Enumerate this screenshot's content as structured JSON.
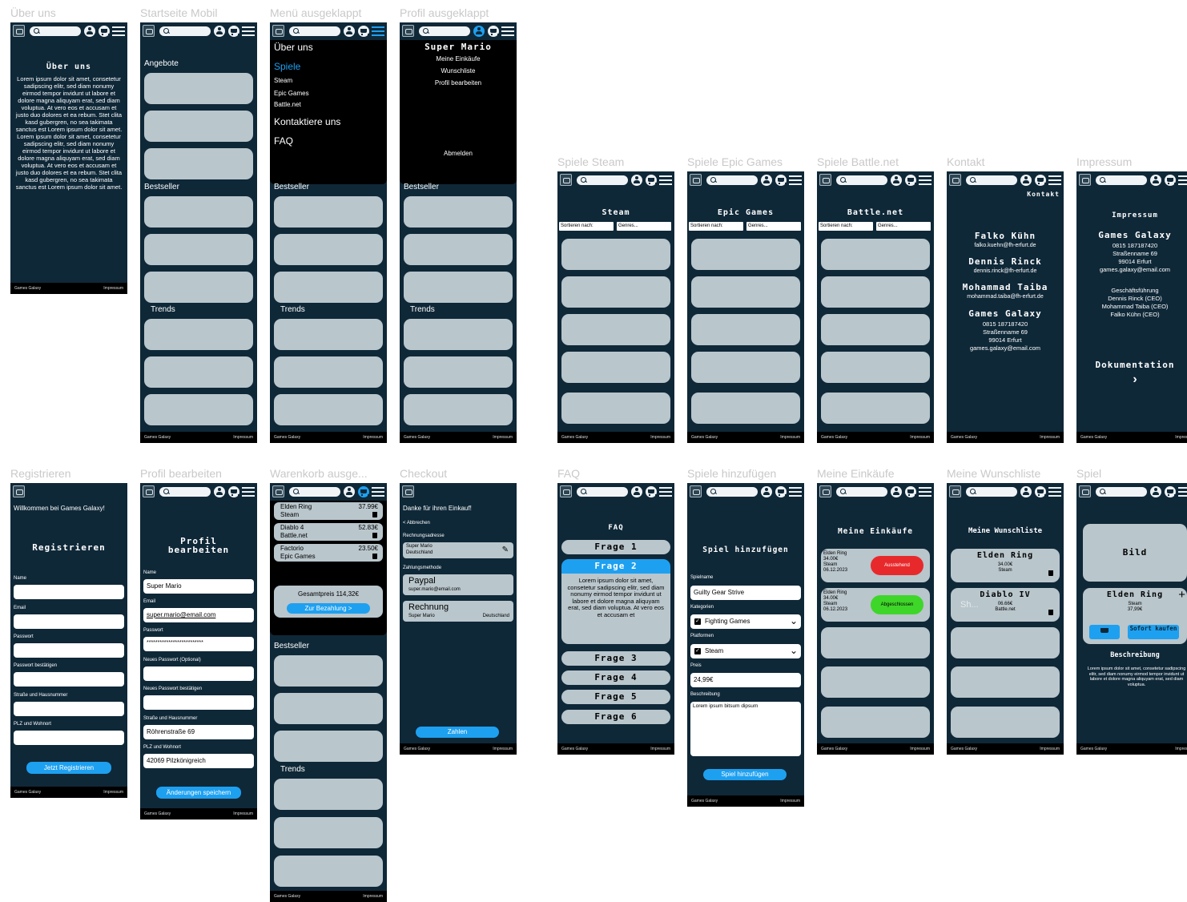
{
  "footer": {
    "left": "Games Galaxy",
    "right": "Impressum"
  },
  "labels": {
    "ueber": "Über uns",
    "start": "Startseite Mobil",
    "menu": "Menü ausgeklappt",
    "profil": "Profil ausgeklappt",
    "steam": "Spiele Steam",
    "epic": "Spiele Epic Games",
    "bnet": "Spiele Battle.net",
    "kontakt": "Kontakt",
    "impressum": "Impressum",
    "registrieren": "Registrieren",
    "profbearb": "Profil bearbeiten",
    "warenkorb": "Warenkorb ausge...",
    "checkout": "Checkout",
    "faq": "FAQ",
    "hinzu": "Spiele hinzufügen",
    "einkaeufe": "Meine Einkäufe",
    "wunsch": "Meine Wunschliste",
    "spiel": "Spiel"
  },
  "sections": {
    "angebote": "Angebote",
    "bestseller": "Bestseller",
    "trends": "Trends"
  },
  "ueber": {
    "title": "Über uns",
    "text": "Lorem ipsum dolor sit amet, consetetur sadipscing elitr, sed diam nonumy eirmod tempor invidunt ut labore et dolore magna aliquyam erat, sed diam voluptua. At vero eos et accusam et justo duo dolores et ea rebum. Stet clita kasd gubergren, no sea takimata sanctus est Lorem ipsum dolor sit amet. Lorem ipsum dolor sit amet, consetetur sadipscing elitr, sed diam nonumy eirmod tempor invidunt ut labore et dolore magna aliquyam erat, sed diam voluptua. At vero eos et accusam et justo duo dolores et ea rebum. Stet clita kasd gubergren, no sea takimata sanctus est Lorem ipsum dolor sit amet."
  },
  "menu": {
    "ueber": "Über uns",
    "spiele": "Spiele",
    "steam": "Steam",
    "epic": "Epic Games",
    "bnet": "Battle.net",
    "kontakt": "Kontaktiere uns",
    "faq": "FAQ"
  },
  "profil": {
    "name": "Super Mario",
    "items": [
      "Meine Einkäufe",
      "Wunschliste",
      "Profil bearbeiten"
    ],
    "logout": "Abmelden"
  },
  "store": {
    "sort": "Sortieren nach:",
    "genres": "Genres...",
    "steam": "Steam",
    "epic": "Epic Games",
    "bnet": "Battle.net"
  },
  "kontakt": {
    "title": "Kontakt",
    "people": [
      {
        "name": "Falko Kühn",
        "mail": "falko.kuehn@fh-erfurt.de"
      },
      {
        "name": "Dennis Rinck",
        "mail": "dennis.rinck@fh-erfurt.de"
      },
      {
        "name": "Mohammad Taiba",
        "mail": "mohammad.taiba@fh-erfurt.de"
      }
    ],
    "company": "Games Galaxy",
    "address": [
      "0815 187187420",
      "Straßenname 69",
      "99014 Erfurt",
      "games.galaxy@email.com"
    ]
  },
  "impressum": {
    "title": "Impressum",
    "company": "Games Galaxy",
    "address": [
      "0815 187187420",
      "Straßenname 69",
      "99014 Erfurt",
      "games.galaxy@email.com"
    ],
    "lead": [
      "Geschäftsführung",
      "Dennis Rinck (CEO)",
      "Mohammad Taiba (CEO)",
      "Falko Kühn (CEO)"
    ],
    "doc": "Dokumentation",
    "arrow": "›"
  },
  "register": {
    "welcome": "Willkommen bei Games Galaxy!",
    "title": "Registrieren",
    "fields": [
      "Name",
      "Email",
      "Passwort",
      "Passwort bestätigen",
      "Straße und Hausnummer",
      "PLZ und Wohnort"
    ],
    "button": "Jetzt Registrieren"
  },
  "profedit": {
    "title1": "Profil",
    "title2": "bearbeiten",
    "fields": [
      {
        "label": "Name",
        "value": "Super Mario"
      },
      {
        "label": "Email",
        "value": "super.mario@email.com"
      },
      {
        "label": "Passwort",
        "value": "**************************"
      },
      {
        "label": "Neues Passwort (Optional)",
        "value": ""
      },
      {
        "label": "Neues Passwort bestätigen",
        "value": ""
      },
      {
        "label": "Straße und Hausnummer",
        "value": "Röhrenstraße 69"
      },
      {
        "label": "PLZ und Wohnort",
        "value": "42069 Pilzkönigreich"
      }
    ],
    "button": "Änderungen speichern"
  },
  "cart": {
    "items": [
      {
        "name": "Elden Ring",
        "store": "Steam",
        "price": "37.99€"
      },
      {
        "name": "Diablo 4",
        "store": "Battle.net",
        "price": "52.83€"
      },
      {
        "name": "Factorio",
        "store": "Epic Games",
        "price": "23.50€"
      }
    ],
    "total": "Gesamtpreis 114,32€",
    "pay": "Zur Bezahlung >"
  },
  "checkout": {
    "thanks": "Danke für ihren Einkauf!",
    "cancel": "< Abbrechen",
    "billing": "Rechnungsadresse",
    "addr1": "Super Mario",
    "addr2": "Deutschland",
    "method": "Zahlungsmethode",
    "paypal": "Paypal",
    "paypal_mail": "super.mario@email.com",
    "invoice": "Rechnung",
    "invoice_name": "Super Mario",
    "invoice_country": "Deutschland",
    "button": "Zahlen"
  },
  "faq": {
    "title": "FAQ",
    "q": [
      "Frage 1",
      "Frage 2",
      "Frage 3",
      "Frage 4",
      "Frage 5",
      "Frage 6"
    ],
    "answer": "Lorem ipsum dolor sit amet, consetetur sadipscing elitr, sed diam nonumy eirmod tempor invidunt ut labore et dolore magna aliquyam erat, sed diam voluptua. At vero eos et accusam et"
  },
  "add": {
    "title": "Spiel hinzufügen",
    "name_l": "Spielname",
    "name_v": "Guilty Gear Strive",
    "cat_l": "Kategorien",
    "cat_v": "Fighting Games",
    "plat_l": "Platformen",
    "plat_v": "Steam",
    "price_l": "Preis",
    "price_v": "24,99€",
    "desc_l": "Beschreibung",
    "desc_v": "Lorem ipsum bitsum dipsum",
    "button": "Spiel hinzufügen"
  },
  "purchases": {
    "title": "Meine Einkäufe",
    "items": [
      {
        "name": "Elden Ring",
        "price": "34.00€",
        "store": "Steam",
        "date": "06.12.2023",
        "status": "Ausstehend",
        "color": "#e8292c"
      },
      {
        "name": "Elden Ring",
        "price": "34.00€",
        "store": "Steam",
        "date": "06.12.2023",
        "status": "Abgeschlossen",
        "color": "#3fd62a"
      }
    ]
  },
  "wish": {
    "title": "Meine Wunschliste",
    "items": [
      {
        "name": "Elden Ring",
        "price": "34.00€",
        "store": "Steam",
        "ghost": ""
      },
      {
        "name": "Diablo IV",
        "price": "06.66€",
        "store": "Battle.net",
        "ghost": "Sh..."
      }
    ]
  },
  "game": {
    "image": "Bild",
    "name": "Elden Ring",
    "plus": "+",
    "store": "Steam",
    "price": "37,99€",
    "buy": "Sofort kaufen",
    "desc_title": "Beschreibung",
    "desc": "Lorem ipsum dolor sit amet, consetetur sadipscing elitr, sed diam nonumy eirmod tempor invidunt ut labore et dolore magna aliquyam erat, sed diam voluptua."
  },
  "colors": {
    "bg": "#0f2838",
    "card": "#b9c6cc",
    "accent": "#1ea0f0",
    "footer": "#000000"
  }
}
